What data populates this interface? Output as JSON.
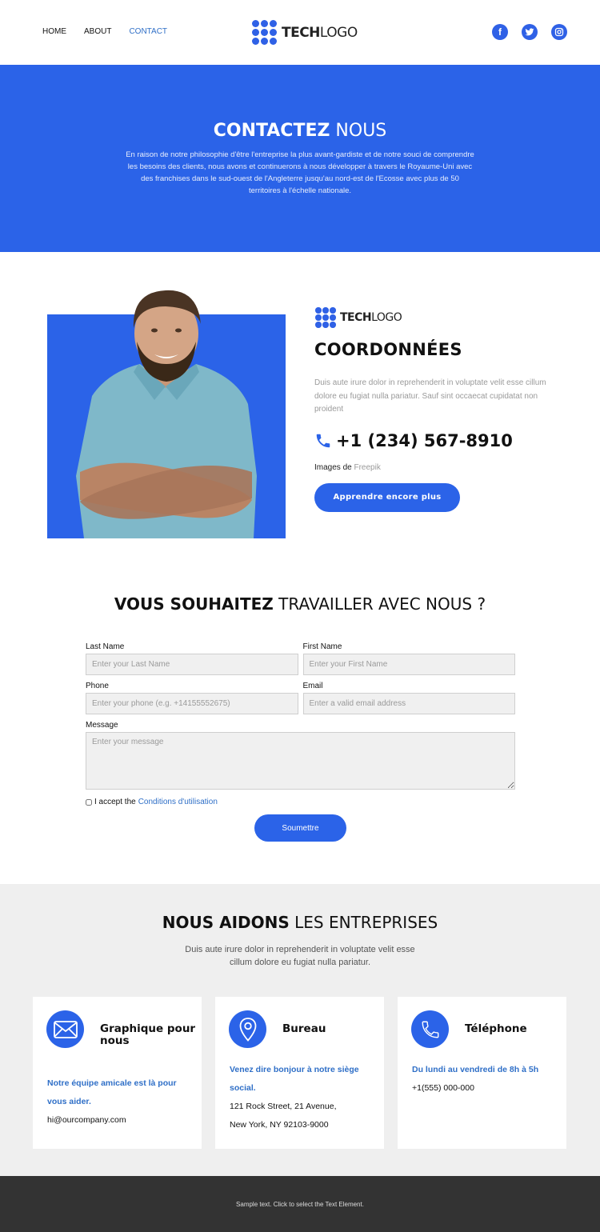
{
  "brand": {
    "bold": "TECH",
    "light": "LOGO",
    "accent": "#2b63e8"
  },
  "nav": [
    {
      "label": "HOME",
      "active": false
    },
    {
      "label": "ABOUT",
      "active": false
    },
    {
      "label": "CONTACT",
      "active": true
    }
  ],
  "social": [
    {
      "icon": "facebook-icon",
      "glyph": "f"
    },
    {
      "icon": "twitter-icon",
      "glyph": "t"
    },
    {
      "icon": "instagram-icon",
      "glyph": "◎"
    }
  ],
  "hero": {
    "title_bold": "CONTACTEZ",
    "title_light": " NOUS",
    "text": "En raison de notre philosophie d'être l'entreprise la plus avant-gardiste et de notre souci de comprendre les besoins des clients, nous avons et continuerons à nous développer à travers le Royaume-Uni avec des franchises dans le sud-ouest de l'Angleterre jusqu'au nord-est de l'Ecosse avec plus de 50 territoires à l'échelle nationale."
  },
  "about": {
    "title": "COORDONNÉES",
    "desc": "Duis aute irure dolor in reprehenderit in voluptate velit esse cillum dolore eu fugiat nulla pariatur. Sauf sint occaecat cupidatat non proident",
    "phone": "+1 (234) 567-8910",
    "credit_prefix": "Images de ",
    "credit_link": "Freepik",
    "button": "Apprendre encore plus"
  },
  "form": {
    "title_bold": "VOUS SOUHAITEZ",
    "title_light": " TRAVAILLER AVEC NOUS ?",
    "fields": {
      "last_name": {
        "label": "Last Name",
        "placeholder": "Enter your Last Name",
        "value": ""
      },
      "first_name": {
        "label": "First Name",
        "placeholder": "Enter your First Name",
        "value": ""
      },
      "phone": {
        "label": "Phone",
        "placeholder": "Enter your phone (e.g. +14155552675)",
        "value": ""
      },
      "email": {
        "label": "Email",
        "placeholder": "Enter a valid email address",
        "value": ""
      },
      "message": {
        "label": "Message",
        "placeholder": "Enter your message",
        "value": ""
      }
    },
    "accept_prefix": "I accept the",
    "accept_link": "Conditions d'utilisation",
    "accept_checked": false,
    "submit": "Soumettre"
  },
  "help": {
    "title_bold": "NOUS AIDONS",
    "title_light": " LES ENTREPRISES",
    "sub": "Duis aute irure dolor in reprehenderit in voluptate velit esse cillum dolore eu fugiat nulla pariatur.",
    "cards": [
      {
        "icon": "envelope-icon",
        "title": "Graphique pour nous",
        "blue": "Notre équipe amicale est là pour vous aider.",
        "lines": [
          "hi@ourcompany.com"
        ]
      },
      {
        "icon": "map-pin-icon",
        "title": "Bureau",
        "blue": "Venez dire bonjour à notre siège social.",
        "lines": [
          "121 Rock Street, 21 Avenue,",
          "New York, NY 92103-9000"
        ]
      },
      {
        "icon": "phone-icon",
        "title": "Téléphone",
        "blue": "Du lundi au vendredi de 8h à 5h",
        "lines": [
          "+1(555) 000-000"
        ]
      }
    ]
  },
  "footer": {
    "text": "Sample text. Click to select the Text Element."
  }
}
